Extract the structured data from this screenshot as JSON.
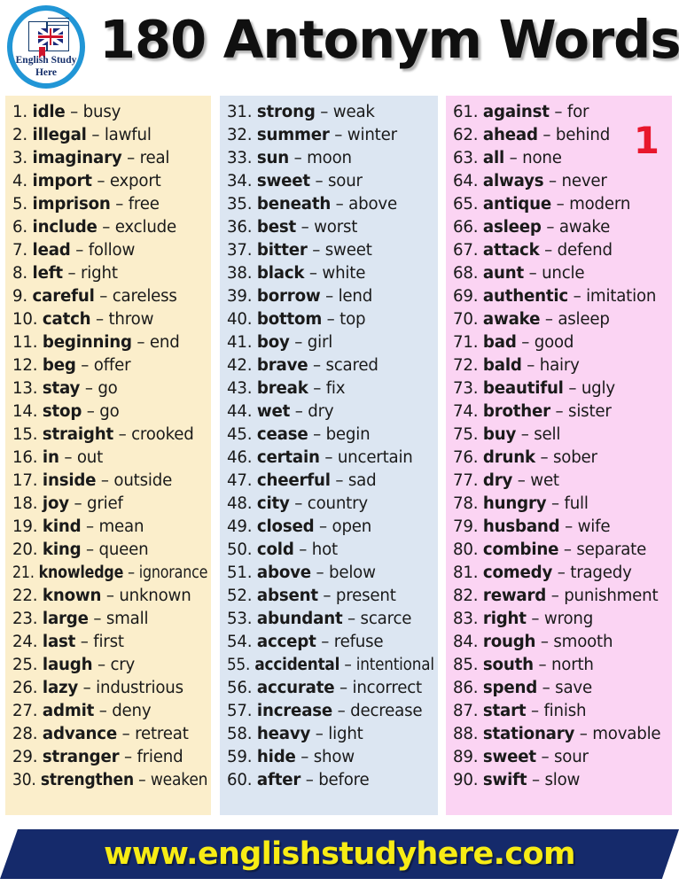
{
  "header": {
    "title": "180 Antonym Words",
    "logo": {
      "brand_line_1": "English Study",
      "brand_line_2": "Here",
      "icon_name": "book-uk-flag-logo"
    }
  },
  "page_number": "1",
  "colors": {
    "column_1_bg": "#fbeecb",
    "column_2_bg": "#dce6f2",
    "column_3_bg": "#fbd4f3",
    "footer_bg": "#152a6b",
    "footer_text": "#f7ec15",
    "page_number": "#e8172c",
    "logo_ring": "#2196d6",
    "logo_brand_text": "#16306b"
  },
  "separator": "–",
  "columns": [
    {
      "name": "column-1",
      "entries": [
        {
          "num": "1.",
          "word": "idle",
          "antonym": "busy"
        },
        {
          "num": "2.",
          "word": "illegal",
          "antonym": "lawful"
        },
        {
          "num": "3.",
          "word": "imaginary",
          "antonym": "real"
        },
        {
          "num": "4.",
          "word": "import",
          "antonym": "export"
        },
        {
          "num": "5.",
          "word": "imprison",
          "antonym": "free"
        },
        {
          "num": "6.",
          "word": "include",
          "antonym": "exclude"
        },
        {
          "num": "7.",
          "word": "lead",
          "antonym": "follow"
        },
        {
          "num": "8.",
          "word": "left",
          "antonym": "right"
        },
        {
          "num": "9.",
          "word": "careful",
          "antonym": "careless"
        },
        {
          "num": "10.",
          "word": "catch",
          "antonym": "throw"
        },
        {
          "num": "11.",
          "word": "beginning",
          "antonym": "end"
        },
        {
          "num": "12.",
          "word": "beg",
          "antonym": "offer"
        },
        {
          "num": "13.",
          "word": "stay",
          "antonym": "go"
        },
        {
          "num": "14.",
          "word": "stop",
          "antonym": "go"
        },
        {
          "num": "15.",
          "word": "straight",
          "antonym": "crooked"
        },
        {
          "num": "16.",
          "word": "in",
          "antonym": "out"
        },
        {
          "num": "17.",
          "word": "inside",
          "antonym": "outside"
        },
        {
          "num": "18.",
          "word": "joy",
          "antonym": "grief"
        },
        {
          "num": "19.",
          "word": "kind",
          "antonym": "mean"
        },
        {
          "num": "20.",
          "word": "king",
          "antonym": "queen"
        },
        {
          "num": "21.",
          "word": "knowledge",
          "antonym": "ignorance"
        },
        {
          "num": "22.",
          "word": "known",
          "antonym": "unknown"
        },
        {
          "num": "23.",
          "word": "large",
          "antonym": "small"
        },
        {
          "num": "24.",
          "word": "last",
          "antonym": "first"
        },
        {
          "num": "25.",
          "word": "laugh",
          "antonym": "cry"
        },
        {
          "num": "26.",
          "word": "lazy",
          "antonym": "industrious"
        },
        {
          "num": "27.",
          "word": "admit",
          "antonym": "deny"
        },
        {
          "num": "28.",
          "word": "advance",
          "antonym": "retreat"
        },
        {
          "num": "29.",
          "word": "stranger",
          "antonym": "friend"
        },
        {
          "num": "30.",
          "word": "strengthen",
          "antonym": "weaken"
        }
      ]
    },
    {
      "name": "column-2",
      "entries": [
        {
          "num": "31.",
          "word": "strong",
          "antonym": "weak"
        },
        {
          "num": "32.",
          "word": "summer",
          "antonym": "winter"
        },
        {
          "num": "33.",
          "word": "sun",
          "antonym": "moon"
        },
        {
          "num": "34.",
          "word": "sweet",
          "antonym": "sour"
        },
        {
          "num": "35.",
          "word": "beneath",
          "antonym": "above"
        },
        {
          "num": "36.",
          "word": "best",
          "antonym": "worst"
        },
        {
          "num": "37.",
          "word": "bitter",
          "antonym": "sweet"
        },
        {
          "num": "38.",
          "word": "black",
          "antonym": "white"
        },
        {
          "num": "39.",
          "word": "borrow",
          "antonym": "lend"
        },
        {
          "num": "40.",
          "word": "bottom",
          "antonym": "top"
        },
        {
          "num": "41.",
          "word": "boy",
          "antonym": "girl"
        },
        {
          "num": "42.",
          "word": "brave",
          "antonym": "scared"
        },
        {
          "num": "43.",
          "word": "break",
          "antonym": "fix"
        },
        {
          "num": "44.",
          "word": "wet",
          "antonym": "dry"
        },
        {
          "num": "45.",
          "word": "cease",
          "antonym": "begin"
        },
        {
          "num": "46.",
          "word": "certain",
          "antonym": "uncertain"
        },
        {
          "num": "47.",
          "word": "cheerful",
          "antonym": "sad"
        },
        {
          "num": "48.",
          "word": "city",
          "antonym": "country"
        },
        {
          "num": "49.",
          "word": "closed",
          "antonym": "open"
        },
        {
          "num": "50.",
          "word": "cold",
          "antonym": "hot"
        },
        {
          "num": "51.",
          "word": "above",
          "antonym": "below"
        },
        {
          "num": "52.",
          "word": "absent",
          "antonym": "present"
        },
        {
          "num": "53.",
          "word": "abundant",
          "antonym": "scarce"
        },
        {
          "num": "54.",
          "word": "accept",
          "antonym": "refuse"
        },
        {
          "num": "55.",
          "word": "accidental",
          "antonym": "intentional"
        },
        {
          "num": "56.",
          "word": "accurate",
          "antonym": "incorrect"
        },
        {
          "num": "57.",
          "word": "increase",
          "antonym": "decrease"
        },
        {
          "num": "58.",
          "word": "heavy",
          "antonym": "light"
        },
        {
          "num": "59.",
          "word": "hide",
          "antonym": "show"
        },
        {
          "num": "60.",
          "word": "after",
          "antonym": "before"
        }
      ]
    },
    {
      "name": "column-3",
      "entries": [
        {
          "num": "61.",
          "word": "against",
          "antonym": "for"
        },
        {
          "num": "62.",
          "word": "ahead",
          "antonym": "behind"
        },
        {
          "num": "63.",
          "word": "all",
          "antonym": "none"
        },
        {
          "num": "64.",
          "word": "always",
          "antonym": "never"
        },
        {
          "num": "65.",
          "word": "antique",
          "antonym": "modern"
        },
        {
          "num": "66.",
          "word": "asleep",
          "antonym": "awake"
        },
        {
          "num": "67.",
          "word": "attack",
          "antonym": "defend"
        },
        {
          "num": "68.",
          "word": "aunt",
          "antonym": "uncle"
        },
        {
          "num": "69.",
          "word": "authentic",
          "antonym": "imitation"
        },
        {
          "num": "70.",
          "word": "awake",
          "antonym": "asleep"
        },
        {
          "num": "71.",
          "word": "bad",
          "antonym": "good"
        },
        {
          "num": "72.",
          "word": "bald",
          "antonym": "hairy"
        },
        {
          "num": "73.",
          "word": "beautiful",
          "antonym": "ugly"
        },
        {
          "num": "74.",
          "word": "brother",
          "antonym": "sister"
        },
        {
          "num": "75.",
          "word": "buy",
          "antonym": "sell"
        },
        {
          "num": "76.",
          "word": "drunk",
          "antonym": "sober"
        },
        {
          "num": "77.",
          "word": "dry",
          "antonym": "wet"
        },
        {
          "num": "78.",
          "word": "hungry",
          "antonym": "full"
        },
        {
          "num": "79.",
          "word": "husband",
          "antonym": "wife"
        },
        {
          "num": "80.",
          "word": "combine",
          "antonym": "separate"
        },
        {
          "num": "81.",
          "word": "comedy",
          "antonym": "tragedy"
        },
        {
          "num": "82.",
          "word": "reward",
          "antonym": "punishment"
        },
        {
          "num": "83.",
          "word": "right",
          "antonym": "wrong"
        },
        {
          "num": "84.",
          "word": "rough",
          "antonym": "smooth"
        },
        {
          "num": "85.",
          "word": "south",
          "antonym": "north"
        },
        {
          "num": "86.",
          "word": "spend",
          "antonym": "save"
        },
        {
          "num": "87.",
          "word": "start",
          "antonym": "finish"
        },
        {
          "num": "88.",
          "word": "stationary",
          "antonym": "movable"
        },
        {
          "num": "89.",
          "word": "sweet",
          "antonym": "sour"
        },
        {
          "num": "90.",
          "word": "swift",
          "antonym": "slow"
        }
      ]
    }
  ],
  "footer": {
    "url": "www.englishstudyhere.com"
  }
}
